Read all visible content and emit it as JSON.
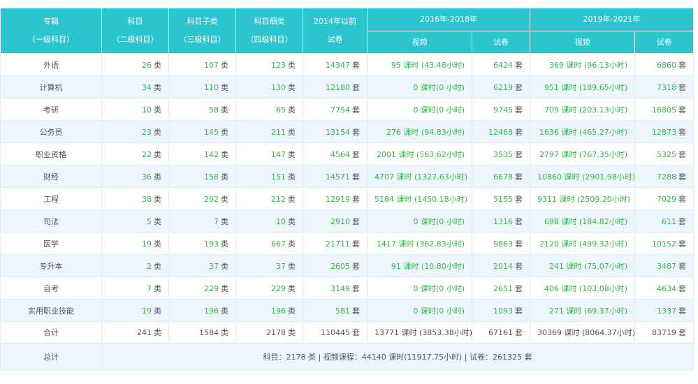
{
  "header": {
    "col1": [
      "专辑",
      "（一级科目）"
    ],
    "col2": [
      "科目",
      "（二级科目）"
    ],
    "col3": [
      "科目子类",
      "（三级科目）"
    ],
    "col4": [
      "科目细类",
      "（四级科目）"
    ],
    "col5": [
      "2014年以前",
      "试卷"
    ],
    "group1": "2016年-2018年",
    "group2": "2019年-2021年",
    "video": "视频",
    "paper": "试卷"
  },
  "units": {
    "lei": "类",
    "tao": "套"
  },
  "rows": [
    {
      "name": "外语",
      "l2": "26",
      "l3": "107",
      "l4": "123",
      "p2014": "14347",
      "v1": "95 课时 (43.48小时)",
      "p1": "6424",
      "v2": "369 课时 (96.13小时)",
      "p2": "6860"
    },
    {
      "name": "计算机",
      "l2": "34",
      "l3": "110",
      "l4": "130",
      "p2014": "12180",
      "v1": "0 课时(0 小时)",
      "p1": "6219",
      "v2": "951 课时 (189.65小时)",
      "p2": "7318"
    },
    {
      "name": "考研",
      "l2": "10",
      "l3": "58",
      "l4": "65",
      "p2014": "7754",
      "v1": "0 课时(0 小时)",
      "p1": "9745",
      "v2": "709 课时 (203.13小时)",
      "p2": "16805"
    },
    {
      "name": "公务员",
      "l2": "23",
      "l3": "145",
      "l4": "211",
      "p2014": "13154",
      "v1": "276 课时 (94.83小时)",
      "p1": "12468",
      "v2": "1636 课时 (465.27小时)",
      "p2": "12873"
    },
    {
      "name": "职业资格",
      "l2": "22",
      "l3": "142",
      "l4": "147",
      "p2014": "4564",
      "v1": "2001 课时 (563.62小时)",
      "p1": "3535",
      "v2": "2797 课时 (767.35小时)",
      "p2": "5325"
    },
    {
      "name": "财经",
      "l2": "36",
      "l3": "158",
      "l4": "151",
      "p2014": "14571",
      "v1": "4707 课时 (1327.63小时)",
      "p1": "6678",
      "v2": "10860 课时 (2901.98小时)",
      "p2": "7288"
    },
    {
      "name": "工程",
      "l2": "38",
      "l3": "202",
      "l4": "212",
      "p2014": "12919",
      "v1": "5184 课时 (1450.18小时)",
      "p1": "5155",
      "v2": "9311 课时 (2509.20小时)",
      "p2": "7029"
    },
    {
      "name": "司法",
      "l2": "5",
      "l3": "7",
      "l4": "10",
      "p2014": "2910",
      "v1": "0 课时(0 小时)",
      "p1": "1316",
      "v2": "698 课时 (184.82小时)",
      "p2": "611"
    },
    {
      "name": "医学",
      "l2": "19",
      "l3": "193",
      "l4": "667",
      "p2014": "21711",
      "v1": "1417 课时 (362.83小时)",
      "p1": "9863",
      "v2": "2120 课时 (499.32小时)",
      "p2": "10152"
    },
    {
      "name": "专升本",
      "l2": "2",
      "l3": "37",
      "l4": "37",
      "p2014": "2605",
      "v1": "91 课时 (10.80小时)",
      "p1": "2014",
      "v2": "241 课时 (75.07小时)",
      "p2": "3487"
    },
    {
      "name": "自考",
      "l2": "7",
      "l3": "229",
      "l4": "229",
      "p2014": "3149",
      "v1": "0 课时(0 小时)",
      "p1": "2651",
      "v2": "406 课时 (103.08小时)",
      "p2": "4634"
    },
    {
      "name": "实用职业技能",
      "l2": "19",
      "l3": "196",
      "l4": "196",
      "p2014": "581",
      "v1": "0 课时(0 小时)",
      "p1": "1093",
      "v2": "271 课时 (69.37小时)",
      "p2": "1337"
    }
  ],
  "total": {
    "name": "合计",
    "l2": "241",
    "l3": "1584",
    "l4": "2178",
    "p2014": "110445",
    "v1": "13771 课时 (3853.38小时)",
    "p1": "67161",
    "v2": "30369 课时 (8064.37小时)",
    "p2": "83719"
  },
  "grand": {
    "name": "总计",
    "summary": "科目：2178 类 | 视频课程：44140 课时(11917.75小时) | 试卷：261325 套"
  }
}
